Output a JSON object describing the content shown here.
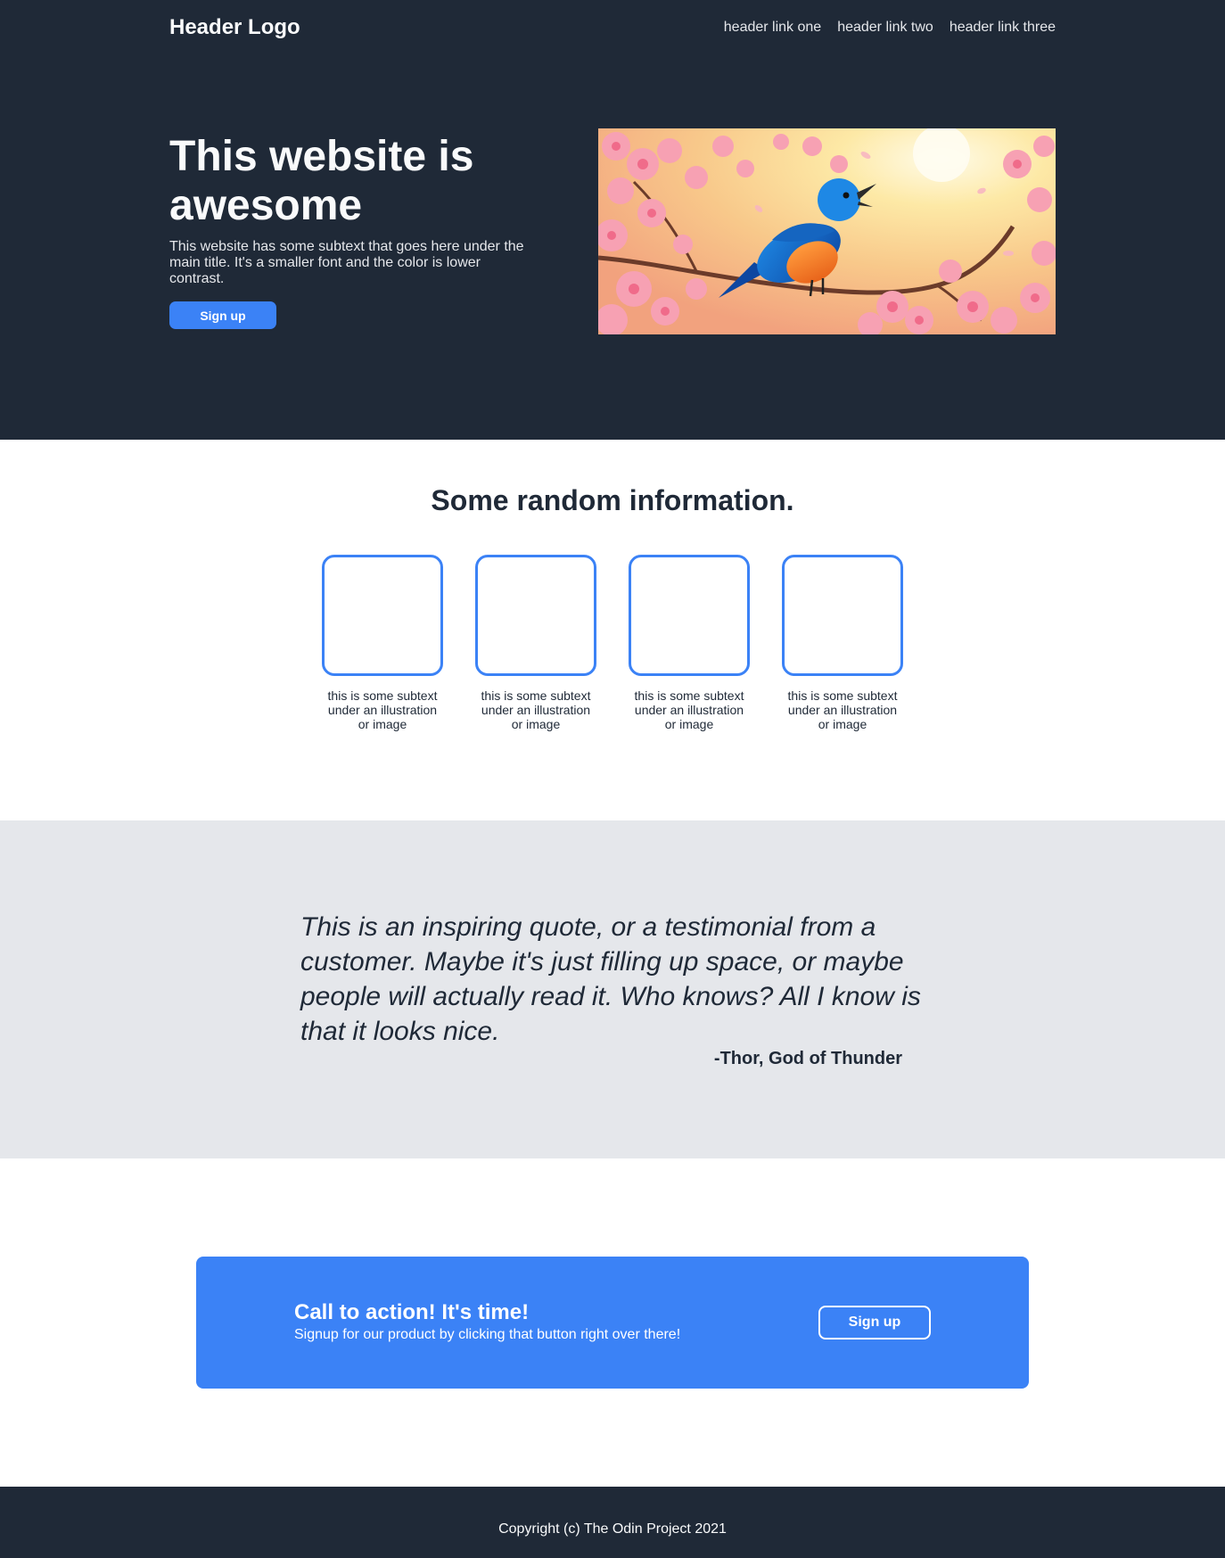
{
  "header": {
    "logo": "Header Logo",
    "links": [
      "header link one",
      "header link two",
      "header link three"
    ]
  },
  "hero": {
    "title": "This website is awesome",
    "subtitle": "This website has some subtext that goes here under the main title. It's a smaller font and the color is lower contrast.",
    "button_label": "Sign up"
  },
  "info": {
    "title": "Some random information.",
    "cards": [
      {
        "text": "this is some subtext under an illustration or image"
      },
      {
        "text": "this is some subtext under an illustration or image"
      },
      {
        "text": "this is some subtext under an illustration or image"
      },
      {
        "text": "this is some subtext under an illustration or image"
      }
    ]
  },
  "quote": {
    "text": "This is an inspiring quote, or a testimonial from a customer. Maybe it's just filling up space, or maybe people will actually read it. Who knows? All I know is that it looks nice.",
    "author": "-Thor, God of Thunder"
  },
  "cta": {
    "title": "Call to action! It's time!",
    "subtitle": "Signup for our product by clicking that button right over there!",
    "button_label": "Sign up"
  },
  "footer": {
    "text": "Copyright (c) The Odin Project 2021"
  },
  "colors": {
    "dark": "#1f2937",
    "accent": "#3b82f6",
    "light_gray": "#e5e7eb"
  }
}
